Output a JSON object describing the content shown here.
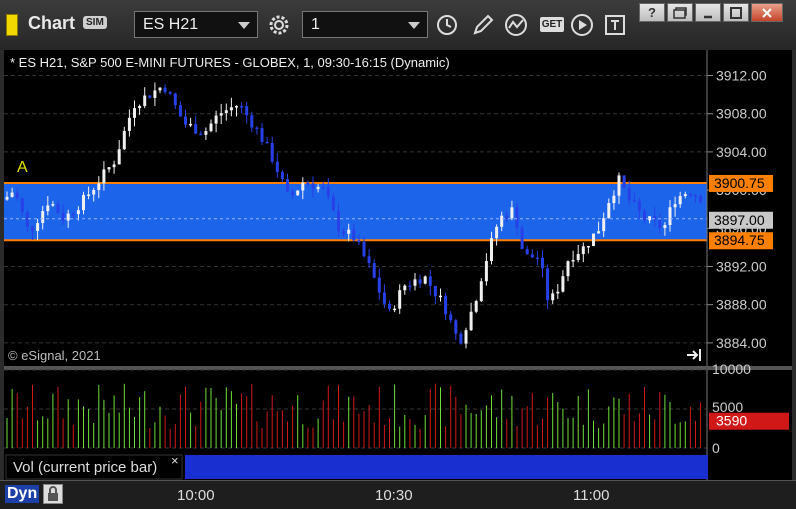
{
  "window": {
    "title": "Chart",
    "badge": "SIM",
    "symbol": "ES H21",
    "interval": "1",
    "get_label": "GET"
  },
  "chart": {
    "header": "* ES H21, S&P 500 E-MINI FUTURES - GLOBEX, 1, 09:30-16:15 (Dynamic)",
    "copyright": "© eSignal, 2021",
    "marker": "A",
    "price_ticks": [
      "3912.00",
      "3908.00",
      "3904.00",
      "3900.00",
      "3896.00",
      "3892.00",
      "3888.00",
      "3884.00"
    ],
    "band_high_label": "3900.75",
    "band_low_label": "3894.75",
    "current_label": "3897.00",
    "band_high": 3900.75,
    "band_low": 3894.75,
    "current": 3897.0,
    "band_color": "#1e6af7",
    "band_edge_color": "#ff8000"
  },
  "volume": {
    "title": "Vol (current price bar)",
    "close": "×",
    "ticks": [
      "10000",
      "5000",
      "0"
    ],
    "current_label": "3590",
    "current": 3590,
    "up_color": "#6fe03a",
    "down_color": "#d01818"
  },
  "footer": {
    "dyn": "Dyn",
    "times": [
      "10:00",
      "10:30",
      "11:00"
    ]
  }
}
